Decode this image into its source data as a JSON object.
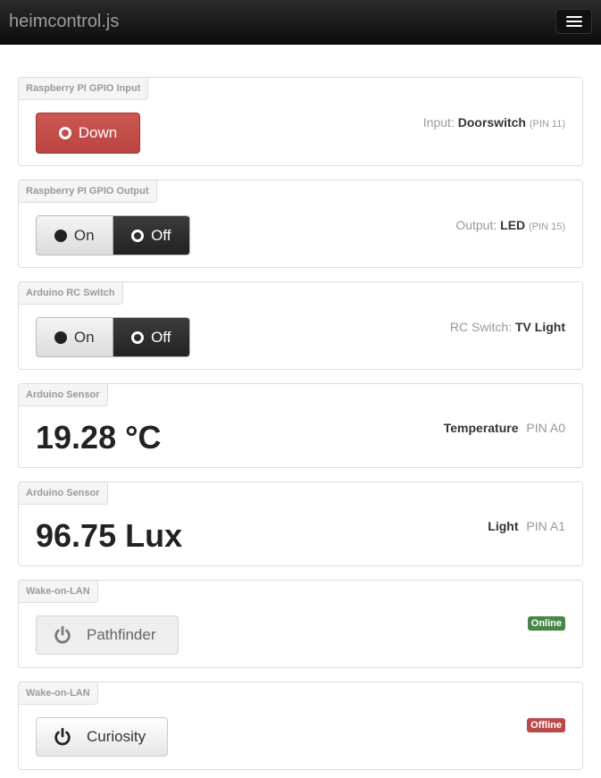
{
  "navbar": {
    "brand": "heimcontrol.js"
  },
  "gpio_input": {
    "label": "Raspberry PI GPIO Input",
    "button_label": "Down",
    "info_prefix": "Input:",
    "info_name": "Doorswitch",
    "info_pin": "(PIN 11)"
  },
  "gpio_output": {
    "label": "Raspberry PI GPIO Output",
    "on_label": "On",
    "off_label": "Off",
    "info_prefix": "Output:",
    "info_name": "LED",
    "info_pin": "(PIN 15)"
  },
  "rc_switch": {
    "label": "Arduino RC Switch",
    "on_label": "On",
    "off_label": "Off",
    "info_prefix": "RC Switch:",
    "info_name": "TV Light"
  },
  "sensor_temp": {
    "label": "Arduino Sensor",
    "value": "19.28 °C",
    "name": "Temperature",
    "pin": "PIN A0"
  },
  "sensor_light": {
    "label": "Arduino Sensor",
    "value": "96.75 Lux",
    "name": "Light",
    "pin": "PIN A1"
  },
  "wol_pathfinder": {
    "label": "Wake-on-LAN",
    "button_label": "Pathfinder",
    "status": "Online",
    "status_color": "#468847"
  },
  "wol_curiosity": {
    "label": "Wake-on-LAN",
    "button_label": "Curiosity",
    "status": "Offline",
    "status_color": "#b94a48"
  }
}
